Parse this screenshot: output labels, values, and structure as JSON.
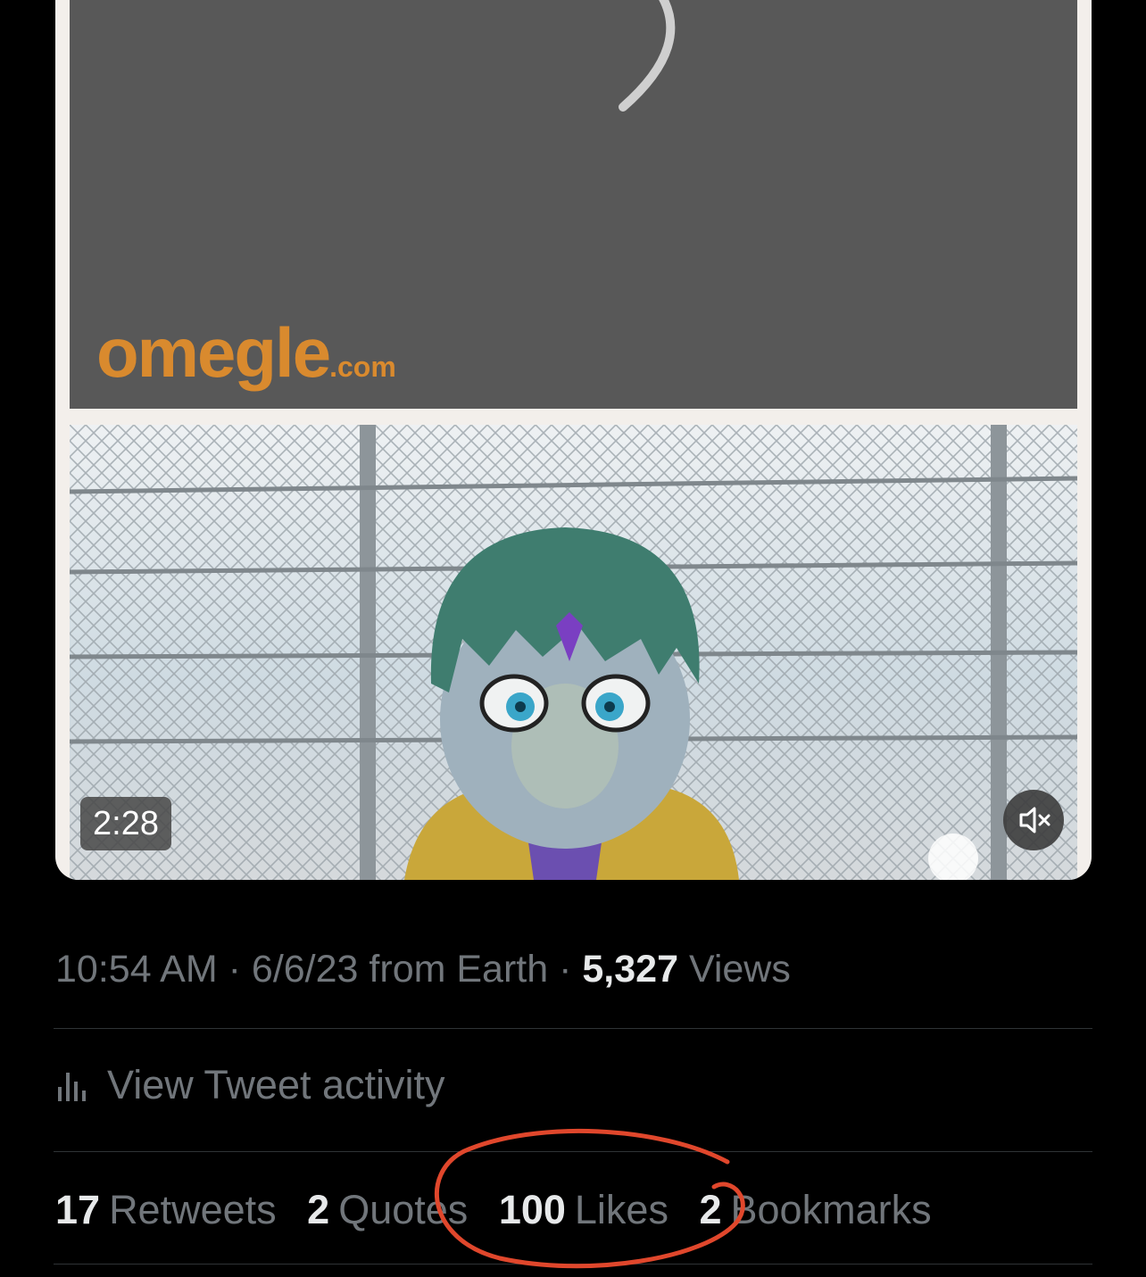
{
  "video": {
    "watermark_brand": "omegle",
    "watermark_domain": ".com",
    "duration": "2:28",
    "mute_icon": "speaker-muted-icon"
  },
  "tweet": {
    "time": "10:54 AM",
    "date": "6/6/23",
    "source": "from Earth",
    "views_count": "5,327",
    "views_label": "Views"
  },
  "activity": {
    "icon": "bar-chart-icon",
    "label": "View Tweet activity"
  },
  "stats": [
    {
      "count": "17",
      "label": "Retweets"
    },
    {
      "count": "2",
      "label": "Quotes"
    },
    {
      "count": "100",
      "label": "Likes"
    },
    {
      "count": "2",
      "label": "Bookmarks"
    }
  ],
  "colors": {
    "annotation_circle": "#e0472c",
    "omegle_orange": "#d98a2e"
  }
}
